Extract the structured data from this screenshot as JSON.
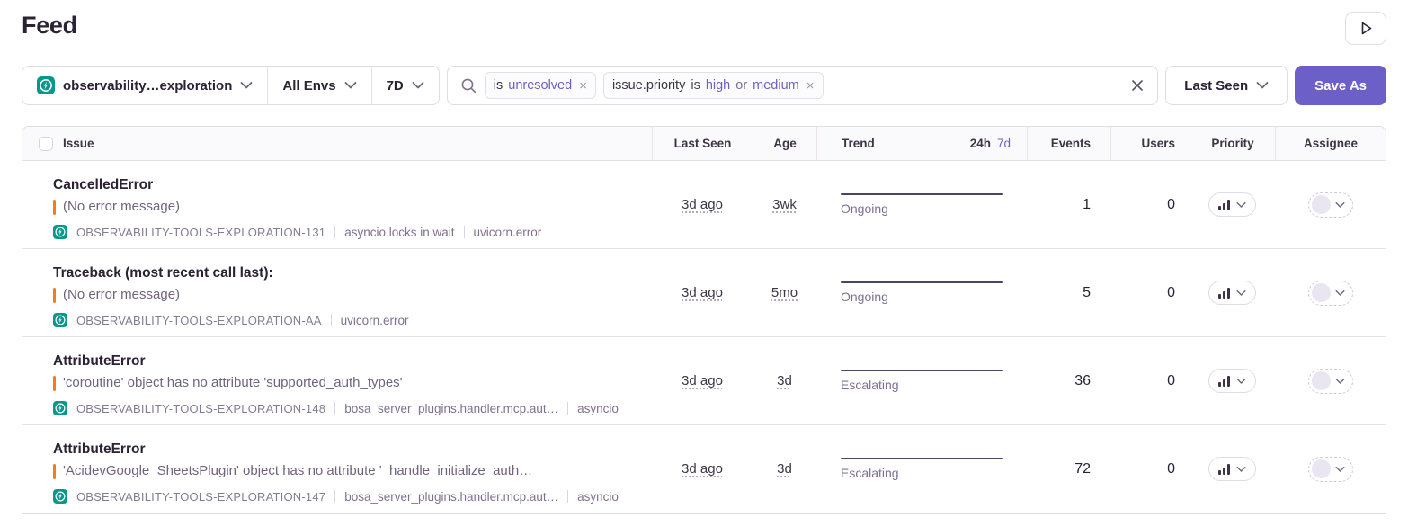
{
  "page": {
    "title": "Feed"
  },
  "colors": {
    "accent_purple": "#6C5FC7",
    "level_orange": "#EE8019",
    "platform_teal": "#05998B",
    "border": "#E0DCE5"
  },
  "icons": {
    "play": "play-triangle",
    "search": "magnifier",
    "chevron": "chevron-down",
    "close": "×",
    "platform": "lightning-bolt",
    "priority": "bar-chart"
  },
  "filters": {
    "project": {
      "label": "observability…exploration"
    },
    "environment": {
      "label": "All Envs"
    },
    "date_range": {
      "label": "7D"
    }
  },
  "search": {
    "tokens": [
      {
        "parts": [
          {
            "text": "is",
            "kind": "key"
          },
          {
            "text": "unresolved",
            "kind": "value"
          }
        ]
      },
      {
        "parts": [
          {
            "text": "issue.priority",
            "kind": "key"
          },
          {
            "text": "is",
            "kind": "op"
          },
          {
            "text": "high",
            "kind": "value"
          },
          {
            "text": "or",
            "kind": "conj"
          },
          {
            "text": "medium",
            "kind": "value"
          }
        ]
      }
    ]
  },
  "actions": {
    "sort_label": "Last Seen",
    "save_as_label": "Save As"
  },
  "table": {
    "columns": {
      "issue": "Issue",
      "last_seen": "Last Seen",
      "age": "Age",
      "trend": "Trend",
      "trend_24h": "24h",
      "trend_7d": "7d",
      "events": "Events",
      "users": "Users",
      "priority": "Priority",
      "assignee": "Assignee"
    },
    "rows": [
      {
        "title": "CancelledError",
        "message": "(No error message)",
        "short_id": "OBSERVABILITY-TOOLS-EXPLORATION-131",
        "annotations": [
          "asyncio.locks in wait",
          "uvicorn.error"
        ],
        "last_seen": "3d ago",
        "age": "3wk",
        "trend_label": "Ongoing",
        "events": "1",
        "users": "0"
      },
      {
        "title": "Traceback (most recent call last):",
        "message": "(No error message)",
        "short_id": "OBSERVABILITY-TOOLS-EXPLORATION-AA",
        "annotations": [
          "uvicorn.error"
        ],
        "last_seen": "3d ago",
        "age": "5mo",
        "trend_label": "Ongoing",
        "events": "5",
        "users": "0"
      },
      {
        "title": "AttributeError",
        "message": "'coroutine' object has no attribute 'supported_auth_types'",
        "short_id": "OBSERVABILITY-TOOLS-EXPLORATION-148",
        "annotations": [
          "bosa_server_plugins.handler.mcp.aut…",
          "asyncio"
        ],
        "last_seen": "3d ago",
        "age": "3d",
        "trend_label": "Escalating",
        "events": "36",
        "users": "0"
      },
      {
        "title": "AttributeError",
        "message": "'AcidevGoogle_SheetsPlugin' object has no attribute '_handle_initialize_auth…",
        "short_id": "OBSERVABILITY-TOOLS-EXPLORATION-147",
        "annotations": [
          "bosa_server_plugins.handler.mcp.aut…",
          "asyncio"
        ],
        "last_seen": "3d ago",
        "age": "3d",
        "trend_label": "Escalating",
        "events": "72",
        "users": "0"
      }
    ]
  }
}
